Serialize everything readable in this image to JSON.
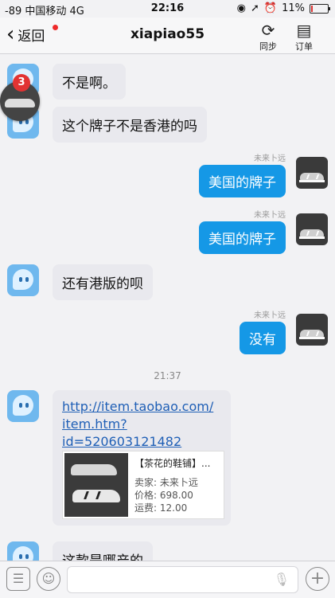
{
  "status": {
    "signal": "-89",
    "carrier": "中国移动",
    "network": "4G",
    "time": "22:16",
    "battery": "11%",
    "battery_level": 0.11
  },
  "nav": {
    "back_label": "返回",
    "title": "xiapiao55",
    "sync_label": "同步",
    "order_label": "订单"
  },
  "badge": {
    "count": "3"
  },
  "messages": [
    {
      "side": "left",
      "text": "不是啊。"
    },
    {
      "side": "left",
      "text": "这个牌子不是香港的吗"
    },
    {
      "side": "right",
      "sender": "未来卜远",
      "text": "美国的牌子"
    },
    {
      "side": "right",
      "sender": "未来卜远",
      "text": "美国的牌子"
    },
    {
      "side": "left",
      "text": "还有港版的呗"
    },
    {
      "side": "right",
      "sender": "未来卜远",
      "text": "没有"
    }
  ],
  "timestamp": "21:37",
  "card": {
    "link": "http://item.taobao.com/item.htm?id=520603121482",
    "link_lines": [
      "http://item.taobao.com/",
      "item.htm?",
      "id=520603121482"
    ],
    "shop": "【茶花的鞋铺】...",
    "seller": "卖家: 未来卜远",
    "price": "价格: 698.00",
    "shipping": "运费: 12.00"
  },
  "last_message": {
    "side": "left",
    "text": "这款是哪产的"
  },
  "input": {
    "placeholder": ""
  },
  "colors": {
    "bubble_out": "#1598e6",
    "bubble_in": "#e9e9ee",
    "link": "#1f5fb6",
    "badge": "#e23333"
  }
}
